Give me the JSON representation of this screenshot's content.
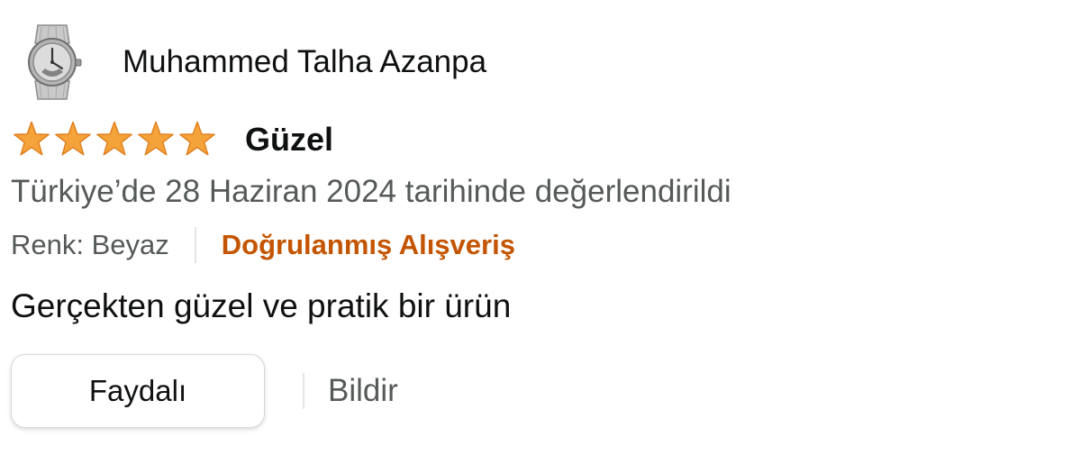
{
  "review": {
    "profile": {
      "name": "Muhammed Talha Azanpa",
      "avatar_icon": "wristwatch-avatar-icon"
    },
    "rating": {
      "value": 5,
      "max": 5,
      "star_color": "#f4a23a",
      "star_outline": "#e07f1f"
    },
    "title": "Güzel",
    "date_text": "Türkiye’de 28 Haziran 2024 tarihinde değerlendirildi",
    "variant": "Renk: Beyaz",
    "verified_label": "Doğrulanmış Alışveriş",
    "verified_color": "#c45500",
    "body": "Gerçekten güzel ve pratik bir ürün",
    "actions": {
      "helpful_label": "Faydalı",
      "report_label": "Bildir"
    }
  }
}
